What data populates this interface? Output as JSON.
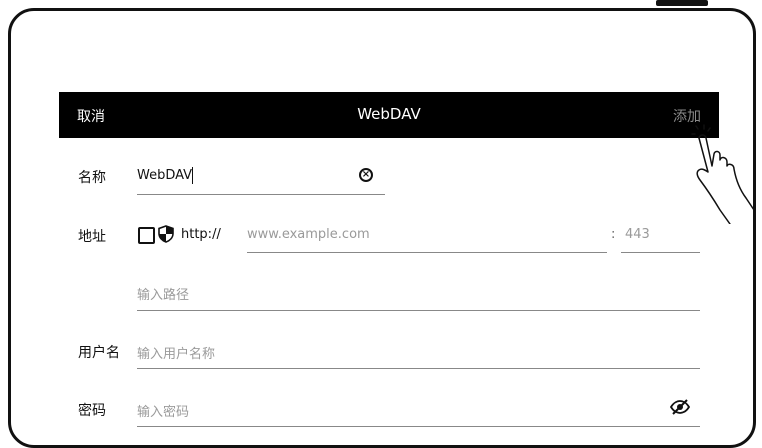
{
  "dialog": {
    "cancel_label": "取消",
    "title": "WebDAV",
    "add_label": "添加"
  },
  "form": {
    "name": {
      "label": "名称",
      "value": "WebDAV"
    },
    "address": {
      "label": "地址",
      "protocol": "http://",
      "host_placeholder": "www.example.com",
      "port_separator": ":",
      "port_placeholder": "443",
      "path_placeholder": "输入路径"
    },
    "username": {
      "label": "用户名",
      "placeholder": "输入用户名称"
    },
    "password": {
      "label": "密码",
      "placeholder": "输入密码"
    }
  },
  "icons": {
    "clear": "clear-icon",
    "secure": "shield-icon",
    "visibility": "eye-off-icon",
    "gesture": "hand-tap-icon"
  },
  "colors": {
    "header_bg": "#000000",
    "header_text": "#ffffff",
    "add_disabled": "#8a8a8a",
    "placeholder": "#9a9a9a"
  }
}
